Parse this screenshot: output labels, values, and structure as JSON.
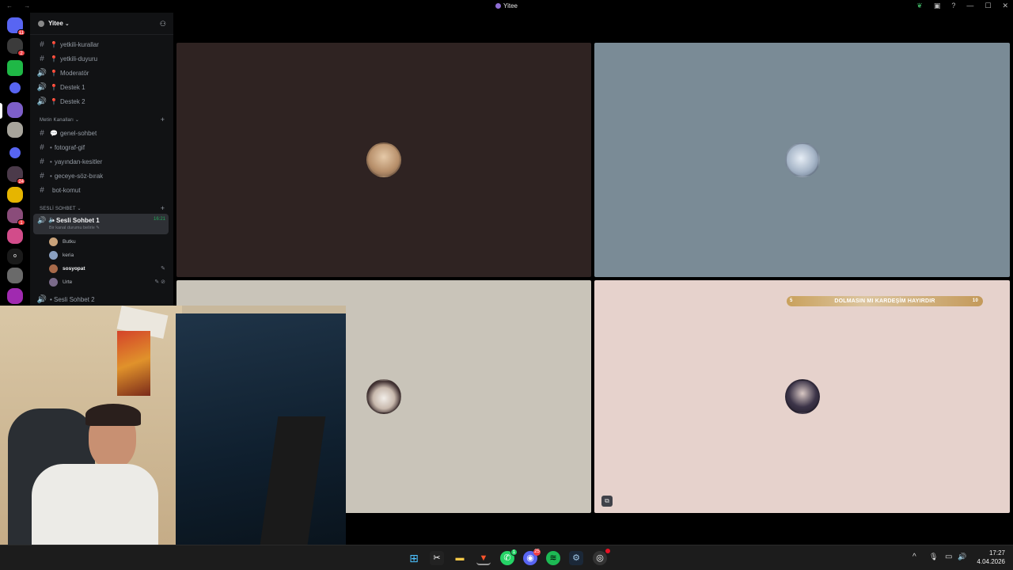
{
  "window": {
    "title": "Yitee",
    "nav_arrows": "← →"
  },
  "titlebar_right": {
    "icons": [
      "leaf-icon",
      "inbox-icon",
      "help-icon",
      "minimize-icon",
      "maximize-icon",
      "close-icon"
    ],
    "glyphs": [
      "❦",
      "▣",
      "?",
      "—",
      "☐",
      "✕"
    ]
  },
  "servers": {
    "badges": [
      "11",
      "2",
      "24",
      "1"
    ]
  },
  "guild": {
    "name": "Yitee",
    "chevron": "⌄"
  },
  "channels_top": [
    {
      "icon": "#",
      "name": "yetkili-kurallar"
    },
    {
      "icon": "#",
      "name": "yetkili-duyuru"
    },
    {
      "icon": "🔊",
      "name": "Moderatör"
    },
    {
      "icon": "🔊",
      "name": "Destek 1"
    },
    {
      "icon": "🔊",
      "name": "Destek 2"
    }
  ],
  "category_text": {
    "label": "Metin Kanalları ⌄",
    "plus": "+"
  },
  "channels_text": [
    {
      "icon": "#",
      "prefix": "💬",
      "name": "genel-sohbet"
    },
    {
      "icon": "#",
      "prefix": "•",
      "name": "fotograf-gif"
    },
    {
      "icon": "#",
      "prefix": "•",
      "name": "yayından-kesitler"
    },
    {
      "icon": "#",
      "prefix": "•",
      "name": "geceye-söz-bırak"
    },
    {
      "icon": "#",
      "prefix": "",
      "name": "bot-komut"
    }
  ],
  "category_voice": {
    "label": "SESLİ SOHBET ⌄",
    "plus": "+"
  },
  "active_voice": {
    "name": "• Sesli Sohbet 1",
    "time": "16:21",
    "status": "Bir kanal durumu belirle ✎"
  },
  "voice_users": [
    {
      "name": "Butku",
      "icons": "",
      "color": "#c9a27a"
    },
    {
      "name": "keria",
      "icons": "",
      "color": "#8aa0c0"
    },
    {
      "name": "sosyopat",
      "icons": "✎",
      "color": "#a86a4a"
    },
    {
      "name": "Urte",
      "icons": "✎ ⊘",
      "color": "#7a6a8a"
    }
  ],
  "voice_channel_2": {
    "icon": "🔊",
    "name": "• Sesli Sohbet 2"
  },
  "tiles": [
    {
      "bg": "#2f2322",
      "avatar": "#c8a98a"
    },
    {
      "bg": "#7a8b96",
      "avatar": "#c3cbd6"
    },
    {
      "bg": "#c9c4b9",
      "avatar": "#5a5050"
    },
    {
      "bg": "#e6d2cc",
      "avatar": "#3a3040"
    }
  ],
  "banner": {
    "left": "5",
    "text": "DOLMASIN MI KARDEŞİM HAYIRDIR",
    "right": "10"
  },
  "taskbar": {
    "apps": [
      {
        "name": "windows-start-icon",
        "glyph": "⊞",
        "bg": "transparent",
        "color": "#4cc2ff"
      },
      {
        "name": "capcut-icon",
        "glyph": "✂",
        "bg": "#222",
        "color": "#fff"
      },
      {
        "name": "file-explorer-icon",
        "glyph": "▬",
        "bg": "transparent",
        "color": "#f7c948"
      },
      {
        "name": "brave-icon",
        "glyph": "▼",
        "bg": "transparent",
        "color": "#fb542b"
      },
      {
        "name": "whatsapp-icon",
        "glyph": "✆",
        "bg": "#25d366",
        "color": "#fff"
      },
      {
        "name": "discord-icon",
        "glyph": "◉",
        "bg": "#5865f2",
        "color": "#fff"
      },
      {
        "name": "spotify-icon",
        "glyph": "≋",
        "bg": "#1db954",
        "color": "#000"
      },
      {
        "name": "steam-icon",
        "glyph": "⚙",
        "bg": "#1b2838",
        "color": "#9fc6e4"
      },
      {
        "name": "obs-icon",
        "glyph": "◎",
        "bg": "#333",
        "color": "#eee"
      }
    ],
    "badges": {
      "whatsapp": "1",
      "discord": "25"
    },
    "tray_glyphs": [
      "^",
      "🎙",
      "▭",
      "🔊"
    ],
    "time": "17:27",
    "date": "4.04.2026"
  }
}
